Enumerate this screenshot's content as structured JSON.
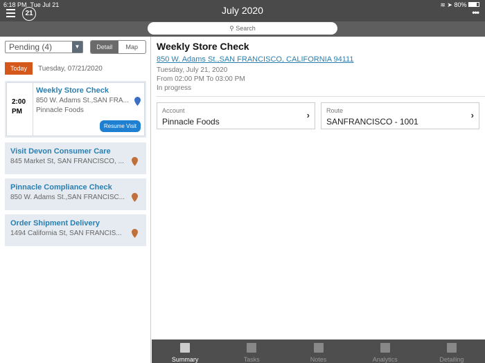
{
  "status": {
    "time": "6:18 PM",
    "date": "Tue Jul 21",
    "battery": "80%"
  },
  "header": {
    "title": "July 2020",
    "badge": "21",
    "search_placeholder": "Search"
  },
  "left": {
    "filter": "Pending (4)",
    "seg": [
      "Detail",
      "Map"
    ],
    "today": "Today",
    "date": "Tuesday, 07/21/2020",
    "visits": [
      {
        "title": "Weekly Store Check",
        "address": "850 W. Adams St.,SAN FRA...",
        "account": "Pinnacle Foods",
        "time": "2:00",
        "ampm": "PM",
        "action": "Resume Visit",
        "pin_color": "#3b6fc4"
      },
      {
        "title": "Visit Devon Consumer Care",
        "address": "845 Market St, SAN FRANCISCO, ...",
        "pin_color": "#c0703a"
      },
      {
        "title": "Pinnacle Compliance Check",
        "address": "850 W. Adams St.,SAN FRANCISC...",
        "pin_color": "#c0703a"
      },
      {
        "title": "Order Shipment Delivery",
        "address": "1494 California St, SAN FRANCIS...",
        "pin_color": "#c0703a"
      }
    ]
  },
  "detail": {
    "title": "Weekly Store Check",
    "address": "850 W. Adams St.,SAN FRANCISCO, CALIFORNIA 94111",
    "date": "Tuesday, July 21, 2020",
    "time": "From 02:00 PM To 03:00 PM",
    "status": "In progress",
    "account_label": "Account",
    "account": "Pinnacle Foods",
    "route_label": "Route",
    "route": "SANFRANCISCO - 1001"
  },
  "tabs": [
    "Summary",
    "Tasks",
    "Notes",
    "Analytics",
    "Detailing"
  ]
}
